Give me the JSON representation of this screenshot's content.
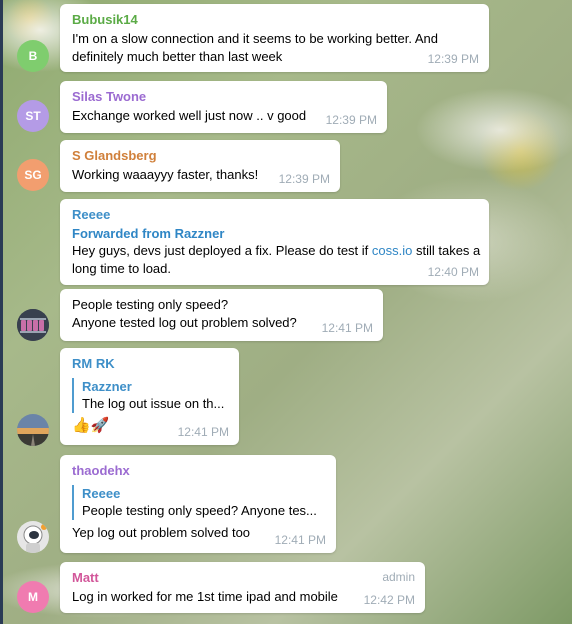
{
  "messages": [
    {
      "sender": "Bubusik14",
      "sender_color": "#5bab46",
      "avatar": {
        "initials": "B",
        "color": "#7fcd6e"
      },
      "text": "I'm on a slow connection and it seems to be working better. And definitely much better than last week",
      "time": "12:39 PM"
    },
    {
      "sender": "Silas Twone",
      "sender_color": "#9b6bd1",
      "avatar": {
        "initials": "ST",
        "color": "#b49be6"
      },
      "text": "Exchange worked well just now .. v good",
      "time": "12:39 PM"
    },
    {
      "sender": "S Glandsberg",
      "sender_color": "#d0803b",
      "avatar": {
        "initials": "SG",
        "color": "#f29e6f"
      },
      "text": "Working waaayyy faster, thanks!",
      "time": "12:39 PM"
    },
    {
      "sender": "Reeee",
      "sender_color": "#3e8fc8",
      "forwarded": "Forwarded from Razzner",
      "text_before": "Hey guys, devs just deployed a fix. Please do test if ",
      "link": "coss.io",
      "text_after": " still takes a long time to load.",
      "time": "12:40 PM"
    },
    {
      "avatar": {
        "icon": "mining-rig-avatar",
        "color": "#4a5566"
      },
      "text_line1": "People testing only speed?",
      "text_line2": "Anyone tested log out problem solved?",
      "time": "12:41 PM"
    },
    {
      "sender": "RM RK",
      "sender_color": "#3e8fc8",
      "avatar": {
        "icon": "sunset-road-avatar",
        "color": "#7a6a58"
      },
      "reply_name": "Razzner",
      "reply_text": "The log out issue on th...",
      "emoji": "👍🚀",
      "time": "12:41 PM"
    },
    {
      "sender": "thaodehx",
      "sender_color": "#9b6bd1",
      "avatar": {
        "icon": "astronaut-avatar",
        "color": "#e8e8e8"
      },
      "reply_name": "Reeee",
      "reply_text": "People testing only speed? Anyone tes...",
      "text": "Yep log out problem solved too",
      "time": "12:41 PM"
    },
    {
      "sender": "Matt",
      "sender_color": "#d2579a",
      "badge": "admin",
      "avatar": {
        "initials": "M",
        "color": "#f07bb0"
      },
      "text": "Log in worked for me 1st time ipad and mobile",
      "time": "12:42 PM"
    }
  ]
}
